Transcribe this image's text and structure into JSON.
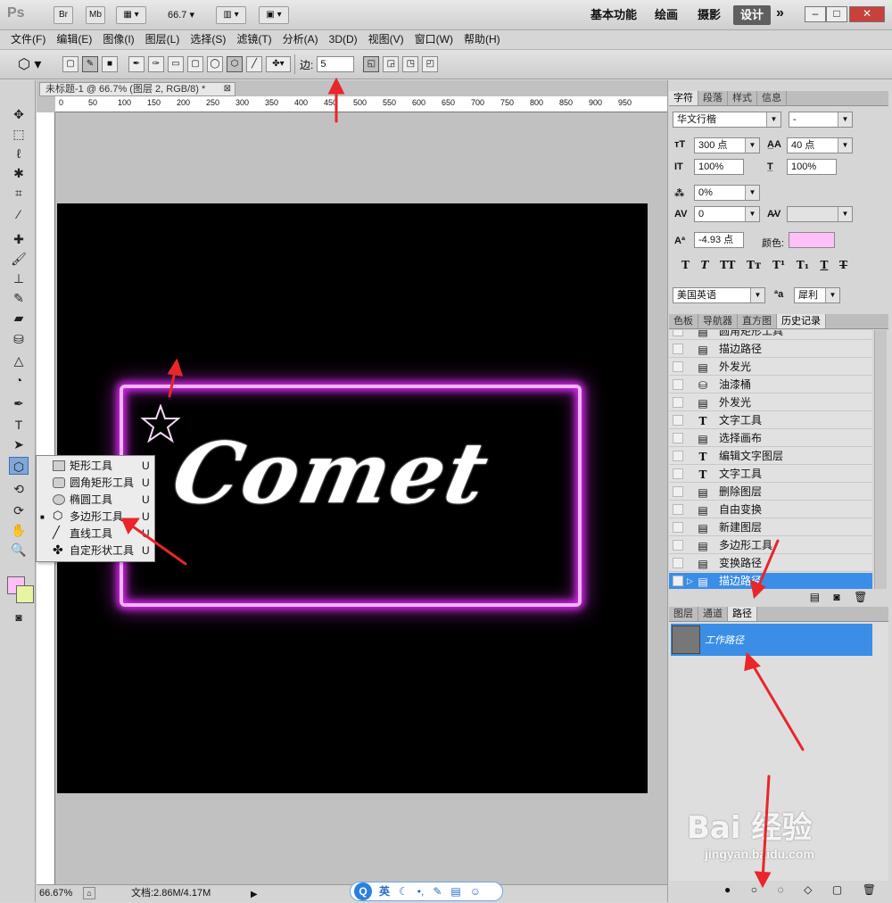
{
  "app": {
    "logo": "Ps",
    "bridge": "Br",
    "minibridge": "Mb",
    "zoom": "66.7",
    "workspaces": [
      "基本功能",
      "绘画",
      "摄影",
      "设计"
    ],
    "active_workspace": "设计"
  },
  "menu": [
    "文件(F)",
    "编辑(E)",
    "图像(I)",
    "图层(L)",
    "选择(S)",
    "滤镜(T)",
    "分析(A)",
    "3D(D)",
    "视图(V)",
    "窗口(W)",
    "帮助(H)"
  ],
  "options": {
    "sides_label": "边:",
    "sides_value": "5"
  },
  "document": {
    "tab_title": "未标题-1 @ 66.7% (图层 2, RGB/8) *",
    "ruler_ticks": [
      "0",
      "50",
      "100",
      "150",
      "200",
      "250",
      "300",
      "350",
      "400",
      "450",
      "500",
      "550",
      "600",
      "650",
      "700",
      "750",
      "800",
      "850",
      "900",
      "950"
    ],
    "canvas_text": "Comet"
  },
  "flyout": [
    {
      "label": "矩形工具",
      "key": "U",
      "selected": false
    },
    {
      "label": "圆角矩形工具",
      "key": "U",
      "selected": false
    },
    {
      "label": "椭圆工具",
      "key": "U",
      "selected": false
    },
    {
      "label": "多边形工具",
      "key": "U",
      "selected": true
    },
    {
      "label": "直线工具",
      "key": "U",
      "selected": false
    },
    {
      "label": "自定形状工具",
      "key": "U",
      "selected": false
    }
  ],
  "status": {
    "zoom": "66.67%",
    "doc": "文档:2.86M/4.17M"
  },
  "ime": {
    "label": "英"
  },
  "character_panel": {
    "tabs": [
      "字符",
      "段落",
      "样式",
      "信息"
    ],
    "font_family": "华文行楷",
    "font_style": "-",
    "font_size": "300 点",
    "leading": "40 点",
    "vertical_scale": "100%",
    "horizontal_scale": "100%",
    "tsume": "0%",
    "kerning": "0",
    "baseline_shift": "-4.93 点",
    "color_label": "颜色:",
    "color_value": "#ffc0f8",
    "language": "美国英语",
    "antialias": "犀利"
  },
  "history_panel": {
    "tabs": [
      "色板",
      "导航器",
      "直方图",
      "历史记录"
    ],
    "items": [
      "圆角矩形工具",
      "描边路径",
      "外发光",
      "油漆桶",
      "外发光",
      "文字工具",
      "选择画布",
      "编辑文字图层",
      "文字工具",
      "删除图层",
      "自由变换",
      "新建图层",
      "多边形工具",
      "变换路径",
      "描边路径"
    ],
    "icons": [
      "doc",
      "doc",
      "doc",
      "bucket",
      "doc",
      "T",
      "doc",
      "T",
      "T",
      "doc",
      "doc",
      "doc",
      "doc",
      "doc",
      "doc"
    ]
  },
  "paths_panel": {
    "tabs": [
      "图层",
      "通道",
      "路径"
    ],
    "work_path": "工作路径"
  },
  "watermark": {
    "brand": "Bai 经验",
    "url": "jingyan.baidu.com"
  },
  "colors": {
    "neon": "#f3b2f8",
    "glow": "#d12ae6",
    "selection": "#3b8ee6",
    "foreground": "#ffc0f8",
    "background": "#e8f5a0"
  }
}
